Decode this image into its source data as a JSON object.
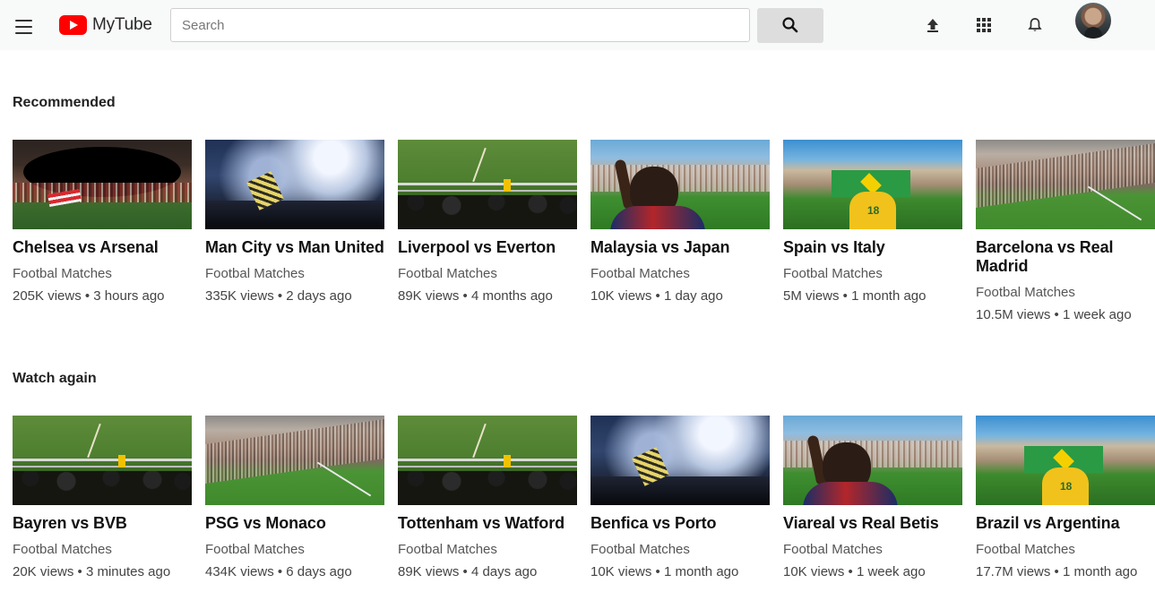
{
  "app": {
    "name": "MyTube"
  },
  "header": {
    "search_placeholder": "Search",
    "icons": [
      "menu-icon",
      "search-icon",
      "upload-icon",
      "apps-icon",
      "bell-icon",
      "avatar"
    ]
  },
  "sections": [
    {
      "title": "Recommended",
      "videos": [
        {
          "title": "Chelsea vs Arsenal",
          "channel": "Footbal Matches",
          "meta": "205K views • 3 hours ago"
        },
        {
          "title": "Man City vs Man United",
          "channel": "Footbal Matches",
          "meta": "335K views • 2 days ago"
        },
        {
          "title": "Liverpool vs Everton",
          "channel": "Footbal Matches",
          "meta": "89K views • 4 months ago"
        },
        {
          "title": "Malaysia vs Japan",
          "channel": "Footbal Matches",
          "meta": "10K views • 1 day ago"
        },
        {
          "title": "Spain vs Italy",
          "channel": "Footbal Matches",
          "meta": "5M views • 1 month ago"
        },
        {
          "title": "Barcelona vs Real Madrid",
          "channel": "Footbal Matches",
          "meta": "10.5M views • 1 week ago"
        }
      ]
    },
    {
      "title": "Watch again",
      "videos": [
        {
          "title": "Bayren vs BVB",
          "channel": "Footbal Matches",
          "meta": "20K views • 3 minutes ago"
        },
        {
          "title": "PSG vs Monaco",
          "channel": "Footbal Matches",
          "meta": "434K views • 6 days ago"
        },
        {
          "title": "Tottenham vs Watford",
          "channel": "Footbal Matches",
          "meta": "89K views • 4 days ago"
        },
        {
          "title": "Benfica vs Porto",
          "channel": "Footbal Matches",
          "meta": "10K views • 1 month ago"
        },
        {
          "title": "Viareal vs Real Betis",
          "channel": "Footbal Matches",
          "meta": "10K views • 1 week ago"
        },
        {
          "title": "Brazil vs Argentina",
          "channel": "Footbal Matches",
          "meta": "17.7M views • 1 month ago"
        }
      ]
    }
  ],
  "colors": {
    "brand": "#ff0000",
    "header_bg": "#f8f9f9",
    "search_button": "#dddddd"
  }
}
